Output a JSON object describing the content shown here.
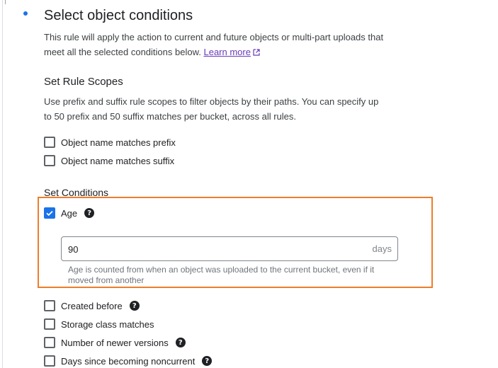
{
  "section": {
    "title": "Select object conditions",
    "description": "This rule will apply the action to current and future objects or multi-part uploads that meet all the selected conditions below.",
    "learn_more": "Learn more"
  },
  "scopes": {
    "heading": "Set Rule Scopes",
    "description": "Use prefix and suffix rule scopes to filter objects by their paths. You can specify up to 50 prefix and 50 suffix matches per bucket, across all rules.",
    "options": [
      {
        "label": "Object name matches prefix",
        "checked": false
      },
      {
        "label": "Object name matches suffix",
        "checked": false
      }
    ]
  },
  "conditions": {
    "heading": "Set Conditions",
    "age": {
      "label": "Age",
      "checked": true,
      "value": "90",
      "suffix": "days",
      "hint": "Age is counted from when an object was uploaded to the current bucket, even if it moved from another"
    },
    "options": [
      {
        "label": "Created before",
        "checked": false,
        "help": true
      },
      {
        "label": "Storage class matches",
        "checked": false,
        "help": false
      },
      {
        "label": "Number of newer versions",
        "checked": false,
        "help": true
      },
      {
        "label": "Days since becoming noncurrent",
        "checked": false,
        "help": true
      }
    ]
  },
  "colors": {
    "accent": "#1a73e8",
    "link": "#673ab7",
    "highlight": "#ee7d2b"
  },
  "icons": {
    "help": "question-mark-circle-icon",
    "external_link": "external-link-icon",
    "check": "checkmark-icon"
  }
}
